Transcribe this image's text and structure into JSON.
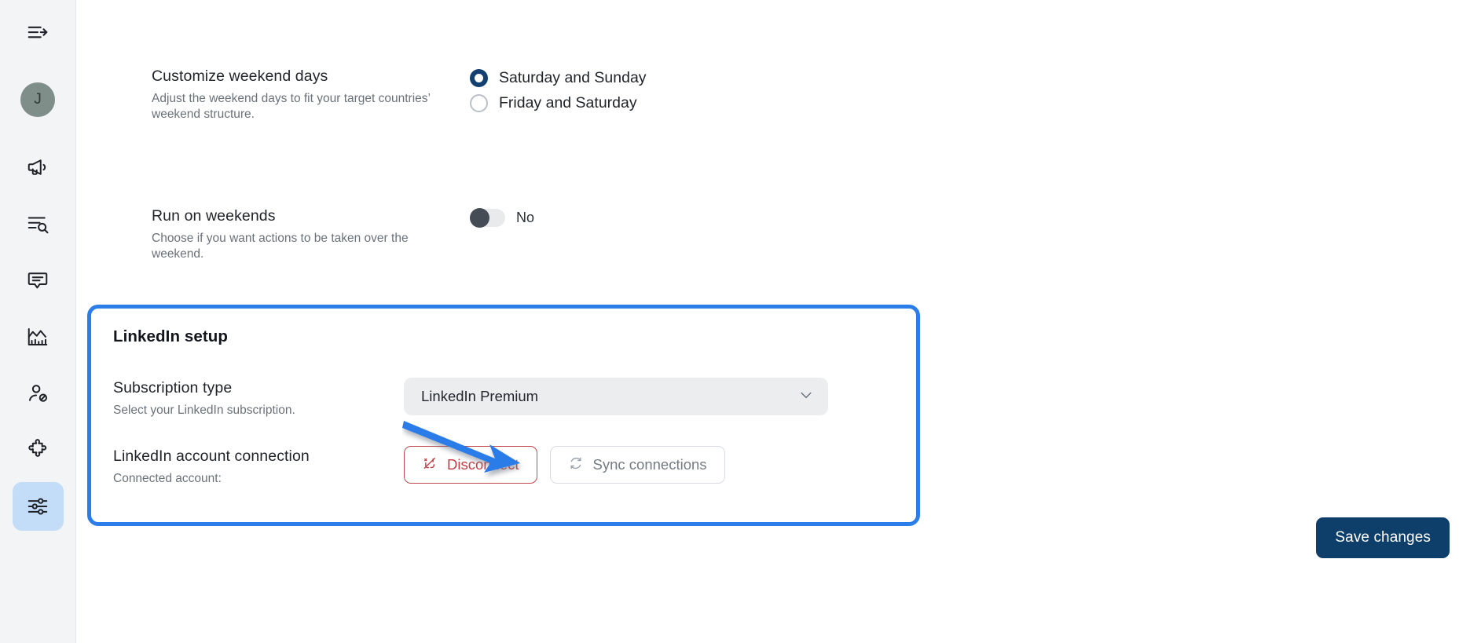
{
  "sidebar": {
    "items": [
      {
        "name": "menu-collapse-icon",
        "label": "Collapse menu",
        "active": false
      },
      {
        "name": "avatar",
        "label": "J",
        "active": false
      },
      {
        "name": "megaphone-icon",
        "label": "Campaigns",
        "active": false
      },
      {
        "name": "list-search-icon",
        "label": "Prospect search",
        "active": false
      },
      {
        "name": "chat-bubble-icon",
        "label": "Inbox",
        "active": false
      },
      {
        "name": "analytics-chart-icon",
        "label": "Analytics",
        "active": false
      },
      {
        "name": "blocked-user-icon",
        "label": "Blocklist",
        "active": false
      },
      {
        "name": "puzzle-piece-icon",
        "label": "Integrations",
        "active": false
      },
      {
        "name": "sliders-settings-icon",
        "label": "Settings",
        "active": true
      }
    ]
  },
  "settings": {
    "weekend_days": {
      "title": "Customize weekend days",
      "description": "Adjust the weekend days to fit your target countries’ weekend structure.",
      "options": [
        {
          "label": "Saturday and Sunday",
          "selected": true
        },
        {
          "label": "Friday and Saturday",
          "selected": false
        }
      ]
    },
    "run_on_weekends": {
      "title": "Run on weekends",
      "description": "Choose if you want actions to be taken over the weekend.",
      "toggle_state": "off",
      "toggle_label": "No"
    }
  },
  "linkedin_setup": {
    "card_title": "LinkedIn setup",
    "subscription": {
      "title": "Subscription type",
      "description": "Select your LinkedIn subscription.",
      "selected_value": "LinkedIn Premium",
      "chevron": "chevron-down-icon"
    },
    "account_connection": {
      "title": "LinkedIn account connection",
      "description": "Connected account:",
      "disconnect_label": "Disconnect",
      "disconnect_icon": "unlink-icon",
      "sync_label": "Sync connections",
      "sync_icon": "refresh-icon"
    }
  },
  "footer": {
    "save_label": "Save changes"
  },
  "annotation": {
    "arrow_target": "disconnect-button",
    "arrow_color": "#2b7de9"
  },
  "colors": {
    "accent_blue": "#2b7de9",
    "navy": "#0e3f6b",
    "danger_red": "#c63e45",
    "sidebar_bg": "#f2f4f5",
    "active_item_bg": "#c3dcf7",
    "avatar_bg": "#7f8e89",
    "select_bg": "#ebedef"
  }
}
